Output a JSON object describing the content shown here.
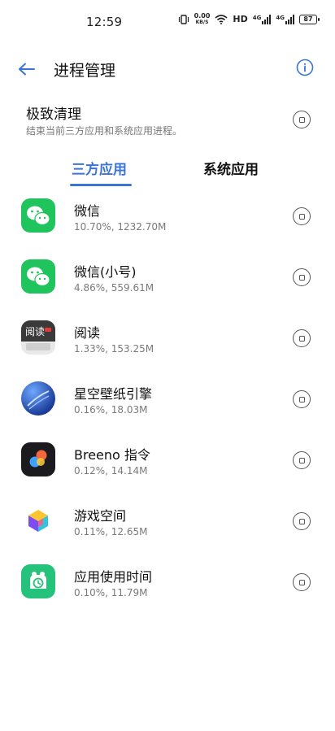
{
  "status_bar": {
    "time": "12:59",
    "net_speed_value": "0.00",
    "net_speed_unit": "KB/S",
    "hd_label": "HD",
    "sim1_label": "4G",
    "sim2_label": "4G",
    "battery_level": "87"
  },
  "header": {
    "title": "进程管理"
  },
  "deep_clean": {
    "title": "极致清理",
    "description": "结束当前三方应用和系统应用进程。"
  },
  "tabs": [
    {
      "label": "三方应用",
      "active": true
    },
    {
      "label": "系统应用",
      "active": false
    }
  ],
  "apps": [
    {
      "name": "微信",
      "usage": "10.70%, 1232.70M",
      "icon": "wechat-icon"
    },
    {
      "name": "微信(小号)",
      "usage": "4.86%, 559.61M",
      "icon": "wechat-icon"
    },
    {
      "name": "阅读",
      "usage": "1.33%, 153.25M",
      "icon": "reader-icon",
      "icon_text": "阅读"
    },
    {
      "name": "星空壁纸引擎",
      "usage": "0.16%, 18.03M",
      "icon": "starry-wallpaper-icon"
    },
    {
      "name": "Breeno 指令",
      "usage": "0.12%, 14.14M",
      "icon": "breeno-icon"
    },
    {
      "name": "游戏空间",
      "usage": "0.11%, 12.65M",
      "icon": "game-space-icon"
    },
    {
      "name": "应用使用时间",
      "usage": "0.10%, 11.79M",
      "icon": "app-usage-time-icon"
    }
  ],
  "colors": {
    "accent": "#3b74d6",
    "wechat_green": "#1fc45c"
  }
}
